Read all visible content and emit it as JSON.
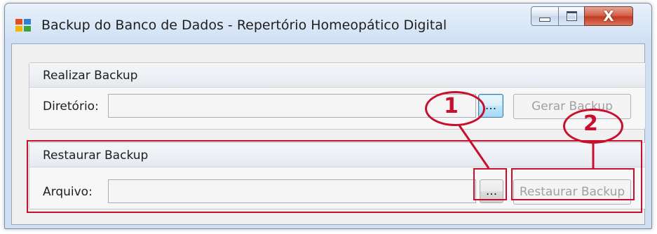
{
  "window": {
    "title": "Backup do Banco de Dados - Repertório Homeopático Digital",
    "minimize_label": "",
    "maximize_label": "",
    "close_label": "X"
  },
  "backup_group": {
    "title": "Realizar Backup",
    "directory_label": "Diretório:",
    "directory_value": "",
    "browse_label": "...",
    "generate_label": "Gerar Backup"
  },
  "restore_group": {
    "title": "Restaurar Backup",
    "file_label": "Arquivo:",
    "file_value": "",
    "browse_label": "...",
    "restore_label": "Restaurar Backup"
  },
  "annotations": {
    "callout_1": "1",
    "callout_2": "2",
    "color": "#c8102e"
  },
  "colors": {
    "title_bar": "#cfe0f4",
    "close_button": "#c23a22",
    "focus_border": "#3c7fb1"
  },
  "icons": {
    "app": "app-window-icon",
    "minimize": "minimize-icon",
    "maximize": "maximize-icon",
    "close": "close-icon"
  }
}
